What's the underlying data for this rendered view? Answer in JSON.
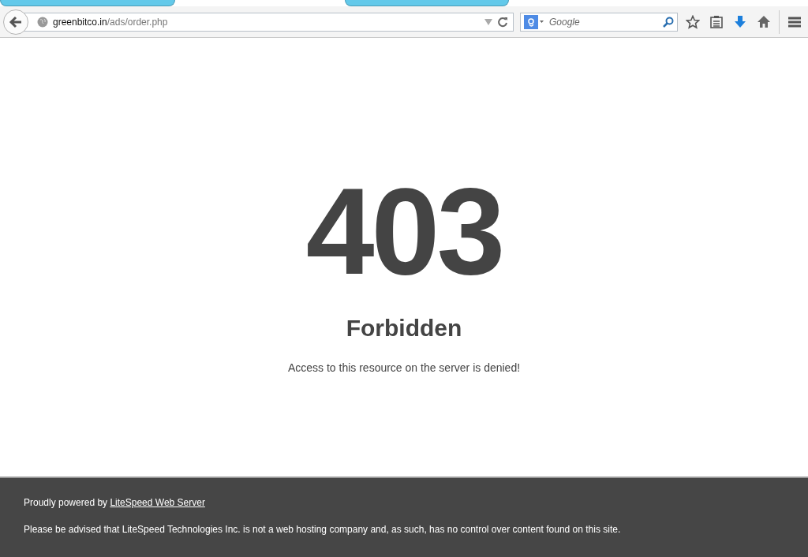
{
  "browser": {
    "url": {
      "host": "greenbitco.in",
      "path": "/ads/order.php"
    },
    "search": {
      "placeholder": "Google"
    }
  },
  "error": {
    "code": "403",
    "title": "Forbidden",
    "message": "Access to this resource on the server is denied!"
  },
  "footer": {
    "powered_prefix": "Proudly powered by ",
    "powered_link": "LiteSpeed Web Server",
    "notice": "Please be advised that LiteSpeed Technologies Inc. is not a web hosting company and, as such, has no control over content found on this site."
  }
}
